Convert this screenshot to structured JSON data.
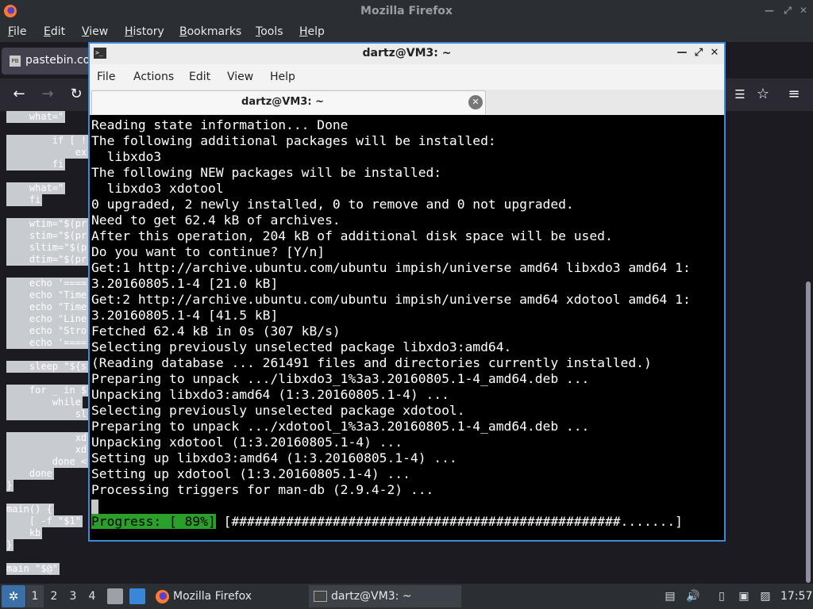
{
  "firefox": {
    "window_title": "Mozilla Firefox",
    "menu": [
      "File",
      "Edit",
      "View",
      "History",
      "Bookmarks",
      "Tools",
      "Help"
    ],
    "tab": {
      "favicon": "PB",
      "label": "pastebin.co"
    },
    "code_lines": [
      "    what=\"",
      "        if [ !",
      "            ex",
      "        fi",
      "    what=\"",
      "    fi",
      "    wtim=\"$(pr",
      "    stim=\"$(pr",
      "    sltim=\"$(p",
      "    dtim=\"$(pr",
      "    echo '====",
      "    echo \"Time",
      "    echo \"Time",
      "    echo \"Line",
      "    echo \"Stro",
      "    echo '====",
      "    sleep \"${s",
      "    for _ in $",
      "        while",
      "            sl",
      "            xd",
      "            xd",
      "        done <",
      "    done",
      "}",
      "main() {",
      "    [ -f \"$1\"",
      "    kb",
      "}",
      "main \"$@\""
    ]
  },
  "terminal": {
    "window_title": "dartz@VM3: ~",
    "menu": [
      "File",
      "Actions",
      "Edit",
      "View",
      "Help"
    ],
    "tab_label": "dartz@VM3: ~",
    "lines": [
      "Reading state information... Done",
      "The following additional packages will be installed:",
      "  libxdo3",
      "The following NEW packages will be installed:",
      "  libxdo3 xdotool",
      "0 upgraded, 2 newly installed, 0 to remove and 0 not upgraded.",
      "Need to get 62.4 kB of archives.",
      "After this operation, 204 kB of additional disk space will be used.",
      "Do you want to continue? [Y/n]",
      "Get:1 http://archive.ubuntu.com/ubuntu impish/universe amd64 libxdo3 amd64 1:",
      "3.20160805.1-4 [21.0 kB]",
      "Get:2 http://archive.ubuntu.com/ubuntu impish/universe amd64 xdotool amd64 1:",
      "3.20160805.1-4 [41.5 kB]",
      "Fetched 62.4 kB in 0s (307 kB/s)",
      "Selecting previously unselected package libxdo3:amd64.",
      "(Reading database ... 261491 files and directories currently installed.)",
      "Preparing to unpack .../libxdo3_1%3a3.20160805.1-4_amd64.deb ...",
      "Unpacking libxdo3:amd64 (1:3.20160805.1-4) ...",
      "Selecting previously unselected package xdotool.",
      "Preparing to unpack .../xdotool_1%3a3.20160805.1-4_amd64.deb ...",
      "Unpacking xdotool (1:3.20160805.1-4) ...",
      "Setting up libxdo3:amd64 (1:3.20160805.1-4) ...",
      "Setting up xdotool (1:3.20160805.1-4) ...",
      "Processing triggers for man-db (2.9.4-2) ..."
    ],
    "progress": {
      "label": "Progress: [ 89%]",
      "bar": " [##################################################.......]",
      "percent": 89
    }
  },
  "taskbar": {
    "workspaces": [
      "1",
      "2",
      "3",
      "4"
    ],
    "active_workspace": "1",
    "tasks": [
      {
        "label": "Mozilla Firefox",
        "icon": "firefox-icon"
      },
      {
        "label": "dartz@VM3: ~",
        "icon": "terminal-icon"
      }
    ],
    "clock": "17:57"
  },
  "colors": {
    "accent_border": "#3c8ad8",
    "progress_green": "#2aa02a",
    "terminal_bg": "#000000"
  }
}
